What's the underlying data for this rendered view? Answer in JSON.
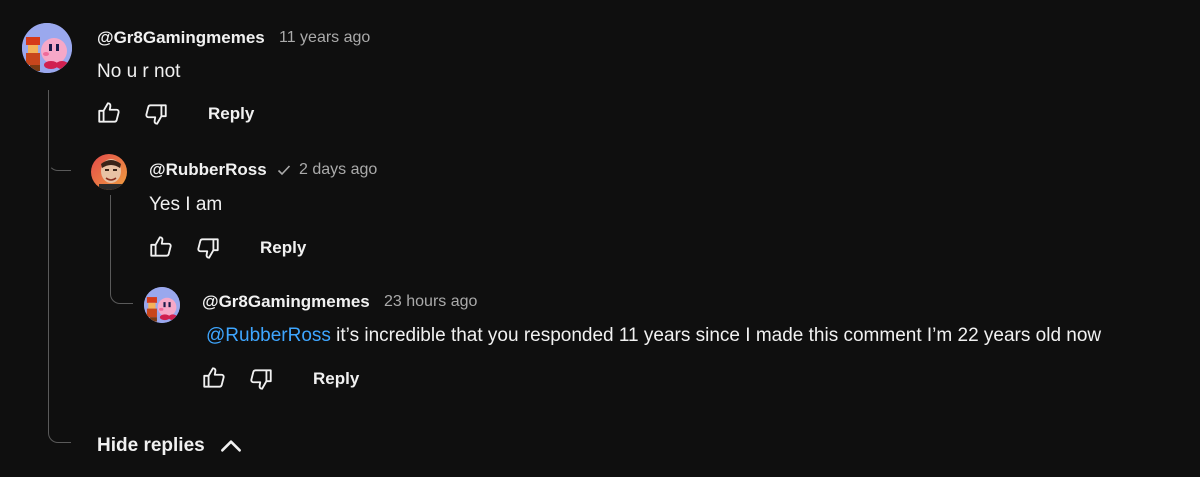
{
  "comment": {
    "handle": "@Gr8Gamingmemes",
    "time": "11 years ago",
    "text": "No u r not",
    "reply_label": "Reply"
  },
  "reply1": {
    "handle": "@RubberRoss",
    "verified": true,
    "time": "2 days ago",
    "text": "Yes I am",
    "reply_label": "Reply"
  },
  "reply2": {
    "handle": "@Gr8Gamingmemes",
    "time": "23 hours ago",
    "mention": "@RubberRoss",
    "text": " it’s incredible that you responded 11 years since I made this comment I’m 22 years old now",
    "reply_label": "Reply"
  },
  "hide_replies_label": "Hide replies",
  "icons": {
    "like": "thumbs-up-icon",
    "dislike": "thumbs-down-icon",
    "verified": "checkmark-icon",
    "collapse": "chevron-up-icon"
  },
  "colors": {
    "background": "#0f0f0f",
    "text": "#f1f1f1",
    "secondary": "#aaaaaa",
    "mention": "#3ea6ff"
  }
}
